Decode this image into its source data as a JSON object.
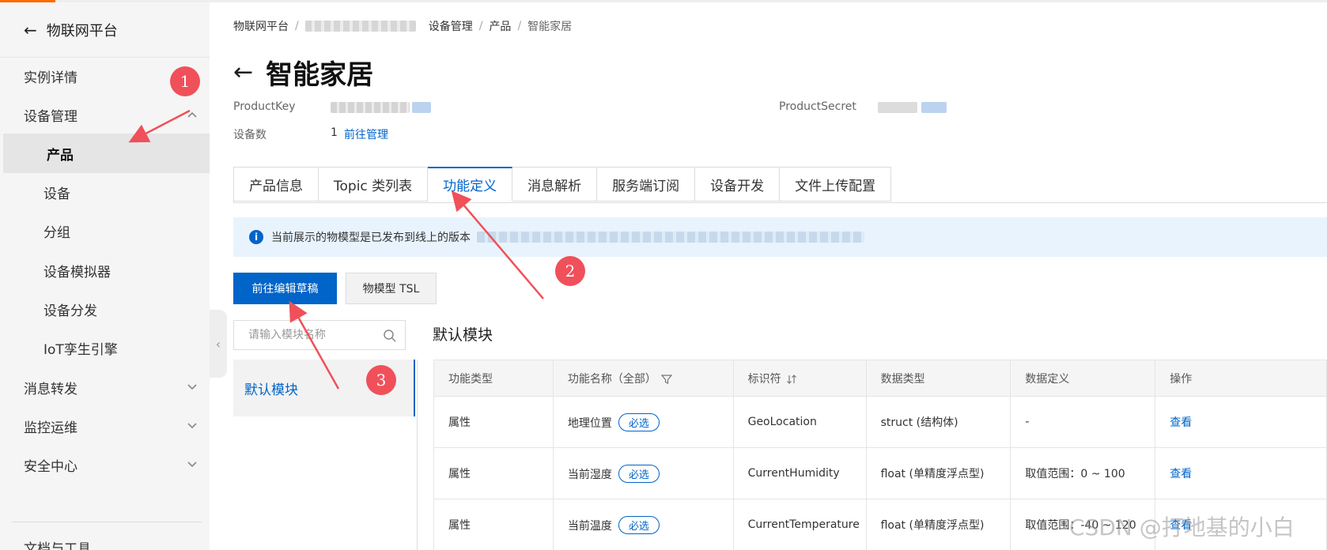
{
  "sidebar": {
    "header": "物联网平台",
    "items": [
      {
        "label": "实例详情"
      },
      {
        "label": "设备管理"
      },
      {
        "label": "产品"
      },
      {
        "label": "设备"
      },
      {
        "label": "分组"
      },
      {
        "label": "设备模拟器"
      },
      {
        "label": "设备分发"
      },
      {
        "label": "IoT孪生引擎"
      },
      {
        "label": "消息转发"
      },
      {
        "label": "监控运维"
      },
      {
        "label": "安全中心"
      },
      {
        "label": "文档与工具"
      }
    ]
  },
  "breadcrumb": {
    "root": "物联网平台",
    "device_mgmt": "设备管理",
    "product": "产品",
    "current": "智能家居"
  },
  "page": {
    "title": "智能家居",
    "product_key_label": "ProductKey",
    "product_secret_label": "ProductSecret",
    "device_count_label": "设备数",
    "device_count": "1",
    "manage_link": "前往管理"
  },
  "tabs": [
    {
      "label": "产品信息"
    },
    {
      "label": "Topic 类列表"
    },
    {
      "label": "功能定义"
    },
    {
      "label": "消息解析"
    },
    {
      "label": "服务端订阅"
    },
    {
      "label": "设备开发"
    },
    {
      "label": "文件上传配置"
    }
  ],
  "notice": {
    "text": "当前展示的物模型是已发布到线上的版本"
  },
  "actions": {
    "edit_draft": "前往编辑草稿",
    "tsl": "物模型 TSL"
  },
  "modules": {
    "search_placeholder": "请输入模块名称",
    "default": "默认模块",
    "section_title": "默认模块"
  },
  "table": {
    "headers": [
      "功能类型",
      "功能名称（全部）",
      "标识符",
      "数据类型",
      "数据定义",
      "操作"
    ],
    "rows": [
      {
        "type": "属性",
        "name": "地理位置",
        "badge": "必选",
        "id": "GeoLocation",
        "dtype": "struct (结构体)",
        "def": "-",
        "op": "查看"
      },
      {
        "type": "属性",
        "name": "当前湿度",
        "badge": "必选",
        "id": "CurrentHumidity",
        "dtype": "float (单精度浮点型)",
        "def": "取值范围：0 ~ 100",
        "op": "查看"
      },
      {
        "type": "属性",
        "name": "当前温度",
        "badge": "必选",
        "id": "CurrentTemperature",
        "dtype": "float (单精度浮点型)",
        "def": "取值范围：-40 ~ 120",
        "op": "查看"
      }
    ]
  },
  "annotations": {
    "m1": "1",
    "m2": "2",
    "m3": "3"
  },
  "watermark": "CSDN @打地基的小白",
  "colors": {
    "primary": "#0064c8",
    "marker": "#f0505a",
    "accent": "#ff6a00"
  }
}
